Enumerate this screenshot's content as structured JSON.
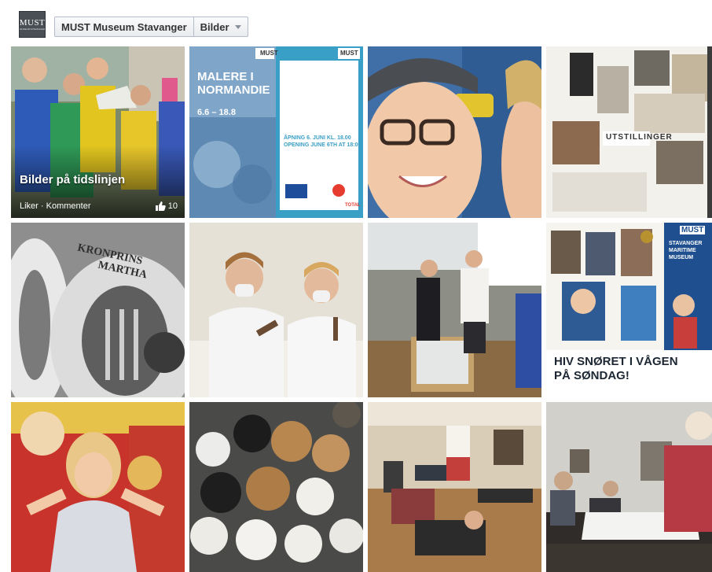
{
  "header": {
    "logo_text": "MUST",
    "logo_sub": "MUSEUM STAVANGER",
    "breadcrumb": [
      {
        "label": "MUST Museum Stavanger"
      },
      {
        "label": "Bilder"
      }
    ]
  },
  "tiles": {
    "timeline": {
      "title": "Bilder på tidslinjen",
      "like": "Liker",
      "separator": " · ",
      "comment": "Kommenter",
      "likes_count": "10"
    },
    "poster": {
      "title_line1": "MALERE I",
      "title_line2": "NORMANDIE",
      "dates": "6.6 – 18.8",
      "opening_line1": "ÅPNING 6. JUNI KL. 18.00",
      "opening_line2": "OPENING JUNE 6TH AT 18:00",
      "logo": "MUST",
      "sponsor": "TOTAL"
    },
    "magazine": {
      "heading": "UTSTILLINGER"
    },
    "ship": {
      "text_line1": "KRONPRINS",
      "text_line2": "MARTHA"
    },
    "flyer": {
      "logo": "MUST",
      "side_line1": "STAVANGER",
      "side_line2": "MARITIME",
      "side_line3": "MUSEUM",
      "headline_line1": "HIV SNØRET I VÅGEN",
      "headline_line2": "PÅ SØNDAG!"
    }
  },
  "colors": {
    "header_border": "#b4bbcd",
    "logo_bg": "#4a4f55",
    "link_text": "#333333"
  }
}
